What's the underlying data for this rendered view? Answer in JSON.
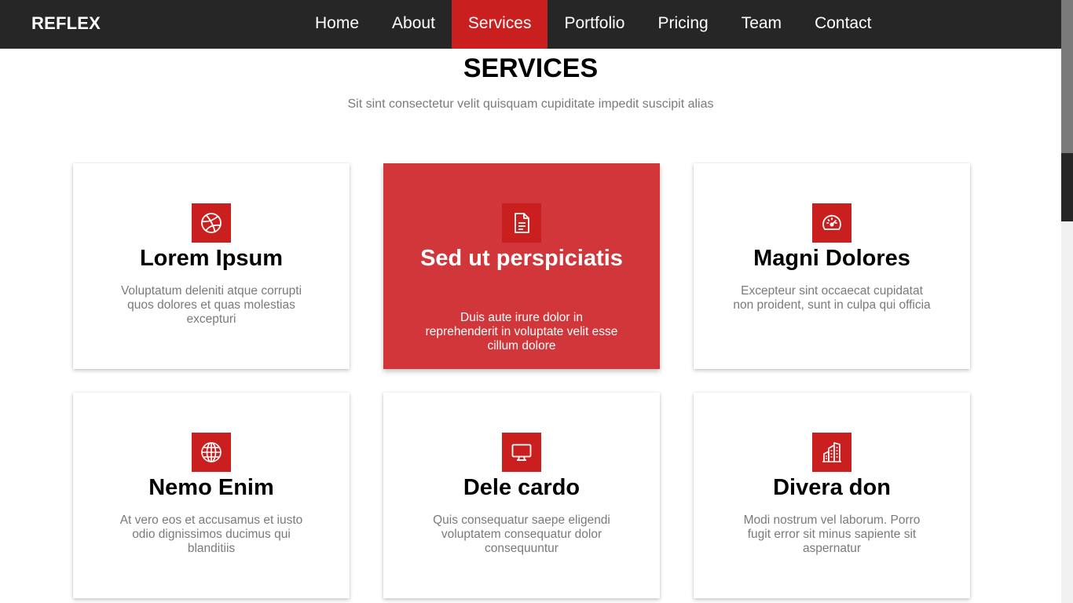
{
  "brand": "REFLEX",
  "nav": {
    "items": [
      "Home",
      "About",
      "Services",
      "Portfolio",
      "Pricing",
      "Team",
      "Contact"
    ],
    "active": "Services"
  },
  "section": {
    "title": "SERVICES",
    "subtitle": "Sit sint consectetur velit quisquam cupiditate impedit suscipit alias"
  },
  "colors": {
    "accent": "#c9201f",
    "highlight_card": "#d1363a",
    "navbar": "#262626"
  },
  "services": [
    {
      "icon": "dribbble-icon",
      "title": "Lorem Ipsum",
      "description": "Voluptatum deleniti atque corrupti quos dolores et quas molestias excepturi"
    },
    {
      "icon": "document-icon",
      "title": "Sed ut perspiciatis",
      "description": "Duis aute irure dolor in reprehenderit in voluptate velit esse cillum dolore"
    },
    {
      "icon": "speedometer-icon",
      "title": "Magni Dolores",
      "description": "Excepteur sint occaecat cupidatat non proident, sunt in culpa qui officia"
    },
    {
      "icon": "globe-icon",
      "title": "Nemo Enim",
      "description": "At vero eos et accusamus et iusto odio dignissimos ducimus qui blanditiis"
    },
    {
      "icon": "monitor-icon",
      "title": "Dele cardo",
      "description": "Quis consequatur saepe eligendi voluptatem consequatur dolor consequuntur"
    },
    {
      "icon": "buildings-icon",
      "title": "Divera don",
      "description": "Modi nostrum vel laborum. Porro fugit error sit minus sapiente sit aspernatur"
    }
  ]
}
